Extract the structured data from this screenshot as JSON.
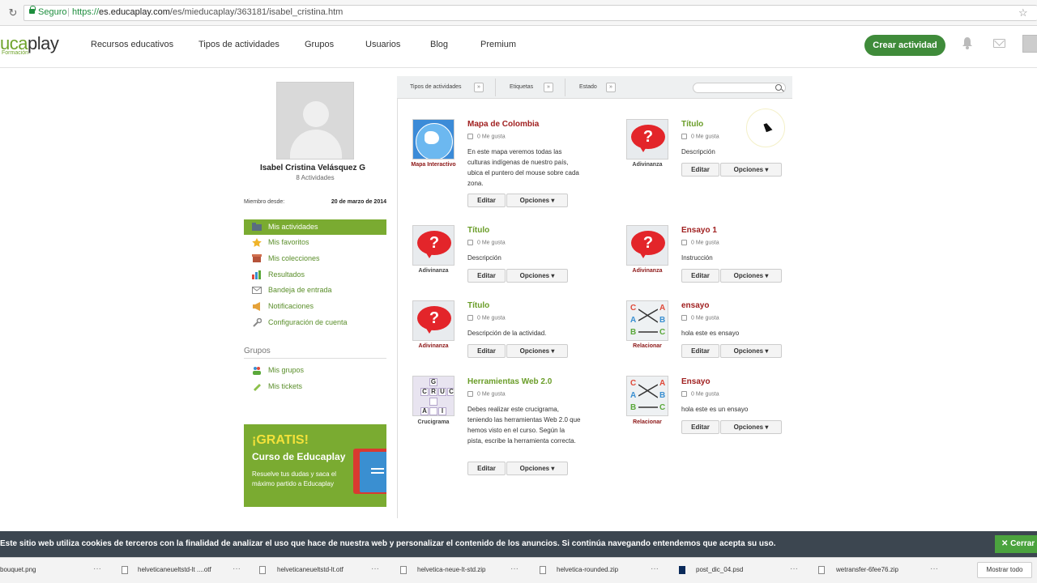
{
  "browser": {
    "secure_label": "Seguro",
    "url_scheme": "https://",
    "url_host": "es.educaplay.com",
    "url_path": "/es/mieducaplay/363181/isabel_cristina.htm"
  },
  "nav": {
    "logo_a": "uca",
    "logo_b": "play",
    "logo_sub": "Formación",
    "links": [
      "Recursos educativos",
      "Tipos de actividades",
      "Grupos",
      "Usuarios",
      "Blog",
      "Premium"
    ],
    "create_label": "Crear actividad"
  },
  "profile": {
    "name": "Isabel Cristina Velásquez G",
    "activities_count": "8 Actividades",
    "member_since_label": "Miembro desde:",
    "member_since_date": "20 de marzo de 2014"
  },
  "sidebar": {
    "items": [
      "Mis actividades",
      "Mis favoritos",
      "Mis colecciones",
      "Resultados",
      "Bandeja de entrada",
      "Notificaciones",
      "Configuración de cuenta"
    ],
    "groups_title": "Grupos",
    "group_items": [
      "Mis grupos",
      "Mis tickets"
    ]
  },
  "promo": {
    "line1": "¡GRATIS!",
    "line2": "Curso de Educaplay",
    "line3": "Resuelve tus dudas y saca el máximo partido a Educaplay"
  },
  "filters": {
    "types": "Tipos de actividades",
    "tags": "Etiquetas",
    "state": "Estado",
    "search_placeholder": ""
  },
  "buttons": {
    "edit": "Editar",
    "options": "Opciones"
  },
  "activities": [
    {
      "title": "Mapa de Colombia",
      "likes": "0 Me gusta",
      "type": "Mapa Interactivo",
      "desc": "En este mapa veremos todas las culturas indígenas de nuestro país, ubica el puntero del mouse sobre cada zona."
    },
    {
      "title": "Título",
      "likes": "0 Me gusta",
      "type": "Adivinanza",
      "desc": "Descripción"
    },
    {
      "title": "Título",
      "likes": "0 Me gusta",
      "type": "Adivinanza",
      "desc": "Descripción"
    },
    {
      "title": "Ensayo 1",
      "likes": "0 Me gusta",
      "type": "Adivinanza",
      "desc": "Instrucción"
    },
    {
      "title": "Título",
      "likes": "0 Me gusta",
      "type": "Adivinanza",
      "desc": "Descripción de la actividad."
    },
    {
      "title": "ensayo",
      "likes": "0 Me gusta",
      "type": "Relacionar",
      "desc": "hola este es ensayo"
    },
    {
      "title": "Herramientas Web 2.0",
      "likes": "0 Me gusta",
      "type": "Crucigrama",
      "desc": "Debes realizar este crucigrama, teniendo las herramientas Web 2.0 que hemos visto en el curso. Según la pista, escribe la herramienta correcta."
    },
    {
      "title": "Ensayo",
      "likes": "0 Me gusta",
      "type": "Relacionar",
      "desc": "hola este es un ensayo"
    }
  ],
  "cookie": {
    "text": "Este sitio web utiliza cookies de terceros con la finalidad de analizar el uso que hace de nuestra web y personalizar el contenido de los anuncios. Si continúa navegando entendemos que acepta su uso.",
    "close": "Cerrar"
  },
  "downloads": {
    "files": [
      "bouquet.png",
      "helveticaneueltstd-lt ....otf",
      "helveticaneueltstd-lt.otf",
      "helvetica-neue-lt-std.zip",
      "helvetica-rounded.zip",
      "post_dic_04.psd",
      "wetransfer-6fee76.zip"
    ],
    "show_all": "Mostrar todo"
  },
  "colors": {
    "brand_green": "#7aab31",
    "create_button": "#3f8b3a",
    "title_red": "#a02020",
    "cookie_bar": "#3c4650"
  },
  "icons": [
    "reload-icon",
    "lock-icon",
    "star-icon",
    "bell-icon",
    "mail-icon",
    "search-icon",
    "thumb-up-icon"
  ]
}
